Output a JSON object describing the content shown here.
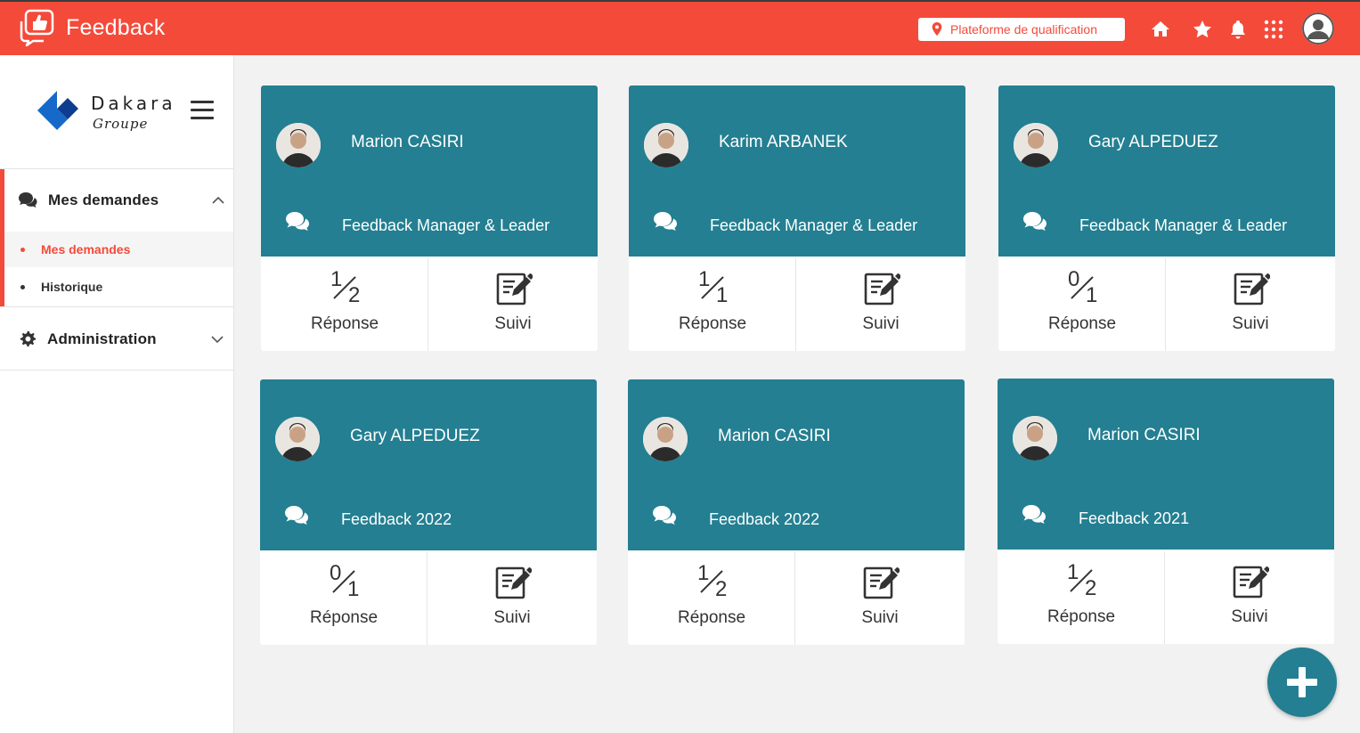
{
  "app": {
    "title": "Feedback"
  },
  "topbar": {
    "platform_label": "Plateforme de qualification",
    "icons": [
      "home-icon",
      "star-icon",
      "bell-icon",
      "apps-grid-icon",
      "user-avatar"
    ]
  },
  "sidebar": {
    "logo": {
      "name": "Dakara",
      "tagline": "Groupe"
    },
    "menu": {
      "mes_demandes": {
        "label": "Mes demandes",
        "items": [
          {
            "label": "Mes demandes",
            "active": true
          },
          {
            "label": "Historique",
            "active": false
          }
        ]
      },
      "administration": {
        "label": "Administration"
      }
    }
  },
  "cards": [
    {
      "name": "Marion CASIRI",
      "form": "Feedback Manager & Leader",
      "answered": "1",
      "total": "2",
      "response_label": "Réponse",
      "follow_label": "Suivi"
    },
    {
      "name": "Karim ARBANEK",
      "form": "Feedback Manager & Leader",
      "answered": "1",
      "total": "1",
      "response_label": "Réponse",
      "follow_label": "Suivi"
    },
    {
      "name": "Gary ALPEDUEZ",
      "form": "Feedback Manager & Leader",
      "answered": "0",
      "total": "1",
      "response_label": "Réponse",
      "follow_label": "Suivi"
    },
    {
      "name": "Gary ALPEDUEZ",
      "form": "Feedback 2022",
      "answered": "0",
      "total": "1",
      "response_label": "Réponse",
      "follow_label": "Suivi"
    },
    {
      "name": "Marion CASIRI",
      "form": "Feedback 2022",
      "answered": "1",
      "total": "2",
      "response_label": "Réponse",
      "follow_label": "Suivi"
    },
    {
      "name": "Marion CASIRI",
      "form": "Feedback 2021",
      "answered": "1",
      "total": "2",
      "response_label": "Réponse",
      "follow_label": "Suivi"
    }
  ],
  "colors": {
    "brand_red": "#f44a3a",
    "card_teal": "#237f91"
  }
}
